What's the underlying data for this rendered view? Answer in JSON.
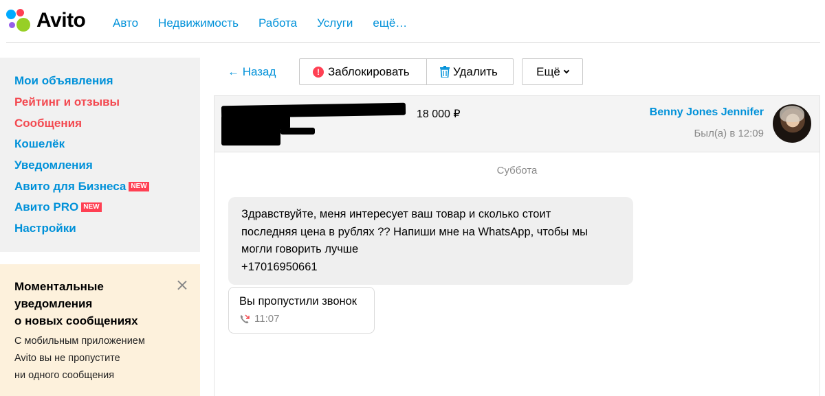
{
  "header": {
    "logo_text": "Avito",
    "nav": [
      "Авто",
      "Недвижимость",
      "Работа",
      "Услуги",
      "ещё…"
    ]
  },
  "sidebar": {
    "items": [
      {
        "label": "Мои объявления",
        "active": false
      },
      {
        "label": "Рейтинг и отзывы",
        "active": true
      },
      {
        "label": "Сообщения",
        "active": true
      },
      {
        "label": "Кошелёк",
        "active": false
      },
      {
        "label": "Уведомления",
        "active": false
      },
      {
        "label": "Авито для Бизнеса",
        "active": false,
        "badge": "NEW"
      },
      {
        "label": "Авито PRO",
        "active": false,
        "badge": "NEW"
      },
      {
        "label": "Настройки",
        "active": false
      }
    ]
  },
  "promo": {
    "title_lines": [
      "Моментальные",
      "уведомления",
      "о новых сообщениях"
    ],
    "text_lines": [
      "С мобильным приложением",
      "Avito вы не пропустите",
      "ни одного сообщения"
    ]
  },
  "toolbar": {
    "back": "← Назад",
    "block": "Заблокировать",
    "delete": "Удалить",
    "more": "Ещё"
  },
  "chat": {
    "listing_price": "18 000 ₽",
    "user_name": "Benny Jones Jennifer",
    "user_status": "Был(а) в 12:09",
    "day_label": "Суббота",
    "message_lines": [
      "Здравствуйте, меня интересует ваш товар и сколько стоит",
      "последняя цена в рублях ?? Напиши мне на WhatsApp, чтобы мы",
      "могли говорить лучше",
      "+17016950661"
    ],
    "missed_call": {
      "title": "Вы пропустили звонок",
      "time": "11:07"
    }
  },
  "colors": {
    "link": "#0091d9",
    "active": "#f3484f",
    "badge": "#ff4053",
    "promo_bg": "#fdf1dc"
  }
}
